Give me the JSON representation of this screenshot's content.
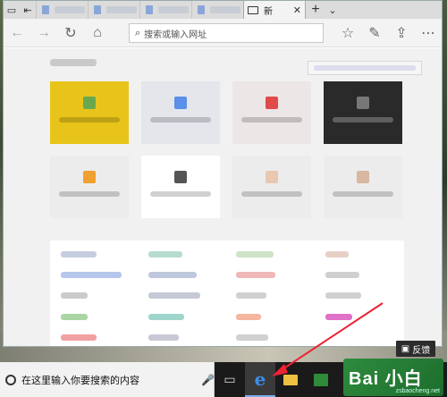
{
  "browser": {
    "active_tab_title": "新",
    "address_placeholder": "搜索或输入网址"
  },
  "feedback": {
    "label": "反馈"
  },
  "taskbar": {
    "search_placeholder": "在这里输入你要搜索的内容"
  },
  "watermark": {
    "text": "zsbaocheng.net",
    "logo": "Bai 小白"
  },
  "tiles": [
    {
      "color": "#e8c41a",
      "icon": "#6aa84f"
    },
    {
      "color": "#e4e6ec",
      "icon": "#5b8fe8"
    },
    {
      "color": "#ece6e6",
      "icon": "#e04a4a"
    },
    {
      "color": "#2a2a2a",
      "icon": "#777777"
    },
    {
      "color": "#ececec",
      "icon": "#f0a030"
    },
    {
      "color": "#ffffff",
      "icon": "#555555"
    },
    {
      "color": "#ececec",
      "icon": "#e8c8b0"
    },
    {
      "color": "#ececec",
      "icon": "#d8b8a0"
    }
  ]
}
